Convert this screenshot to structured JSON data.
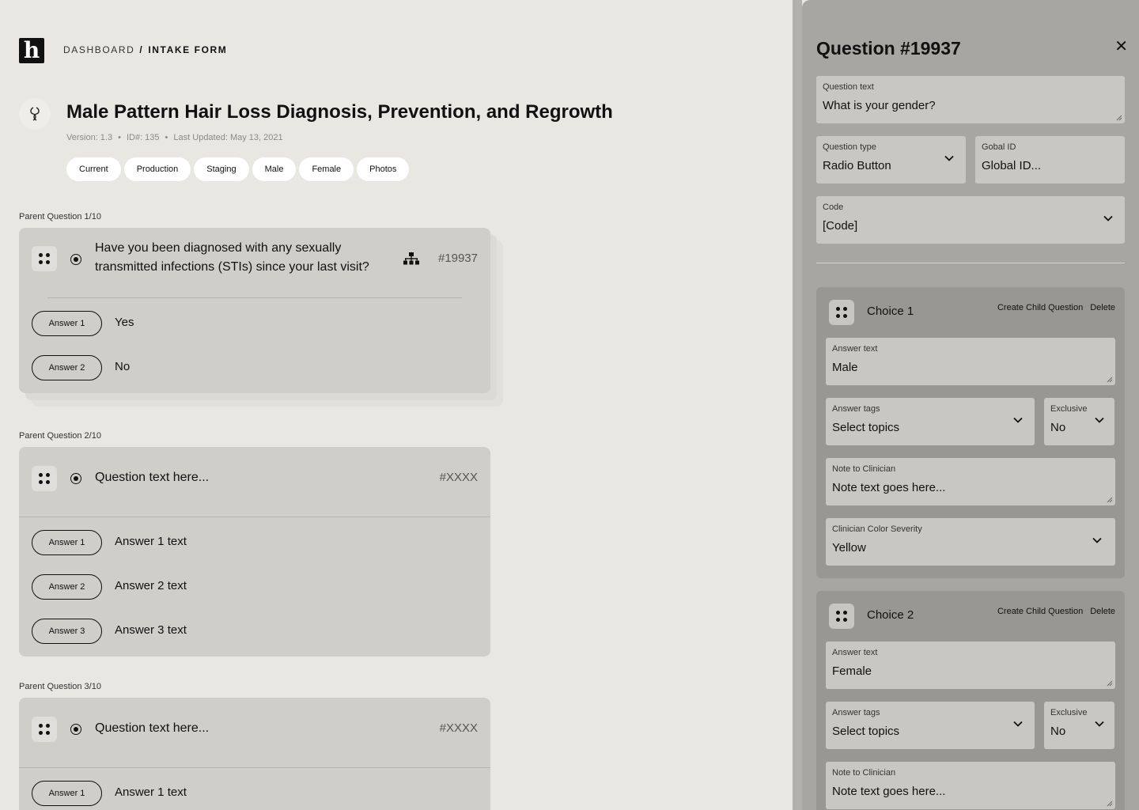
{
  "header": {
    "logo": "h",
    "breadcrumb": {
      "parent": "DASHBOARD",
      "separator": "/",
      "current": "INTAKE FORM"
    }
  },
  "form": {
    "title": "Male Pattern Hair Loss Diagnosis, Prevention, and Regrowth",
    "version": "Version: 1.3",
    "id": "ID#: 135",
    "updated": "Last Updated: May 13, 2021",
    "tags": [
      "Current",
      "Production",
      "Staging",
      "Male",
      "Female",
      "Photos"
    ]
  },
  "questions": [
    {
      "label": "Parent Question 1/10",
      "text_line1": "Have you been diagnosed with any sexually",
      "text_line2": "transmitted infections (STIs) since your last visit?",
      "id": "#19937",
      "answers": [
        {
          "pill": "Answer 1",
          "text": "Yes"
        },
        {
          "pill": "Answer 2",
          "text": "No"
        }
      ]
    },
    {
      "label": "Parent Question 2/10",
      "text": "Question text here...",
      "id": "#XXXX",
      "answers": [
        {
          "pill": "Answer 1",
          "text": "Answer 1 text"
        },
        {
          "pill": "Answer 2",
          "text": "Answer 2 text"
        },
        {
          "pill": "Answer 3",
          "text": "Answer 3 text"
        }
      ]
    },
    {
      "label": "Parent Question 3/10",
      "text": "Question text here...",
      "id": "#XXXX",
      "answers": [
        {
          "pill": "Answer 1",
          "text": "Answer 1 text"
        }
      ]
    }
  ],
  "panel": {
    "title": "Question #19937",
    "question_text": {
      "label": "Question text",
      "value": "What is your gender?"
    },
    "question_type": {
      "label": "Question type",
      "value": "Radio Button"
    },
    "global_id": {
      "label": "Gobal ID",
      "value": "Global ID..."
    },
    "code": {
      "label": "Code",
      "value": "[Code]"
    },
    "choices": [
      {
        "title": "Choice 1",
        "create_child": "Create Child Question",
        "delete": "Delete",
        "answer_text": {
          "label": "Answer text",
          "value": "Male"
        },
        "answer_tags": {
          "label": "Answer tags",
          "value": "Select topics"
        },
        "exclusive": {
          "label": "Exclusive",
          "value": "No"
        },
        "note": {
          "label": "Note to Clinician",
          "value": "Note text goes here..."
        },
        "severity": {
          "label": "Clinician Color Severity",
          "value": "Yellow"
        }
      },
      {
        "title": "Choice 2",
        "create_child": "Create Child Question",
        "delete": "Delete",
        "answer_text": {
          "label": "Answer text",
          "value": "Female"
        },
        "answer_tags": {
          "label": "Answer tags",
          "value": "Select topics"
        },
        "exclusive": {
          "label": "Exclusive",
          "value": "No"
        },
        "note": {
          "label": "Note to Clinician",
          "value": "Note text goes here..."
        }
      }
    ]
  },
  "colors": {
    "background": "#e9e7e2",
    "card": "#d0cec9",
    "panel": "#a8a6a3",
    "choice": "#999794",
    "field": "#c9c7c3"
  }
}
